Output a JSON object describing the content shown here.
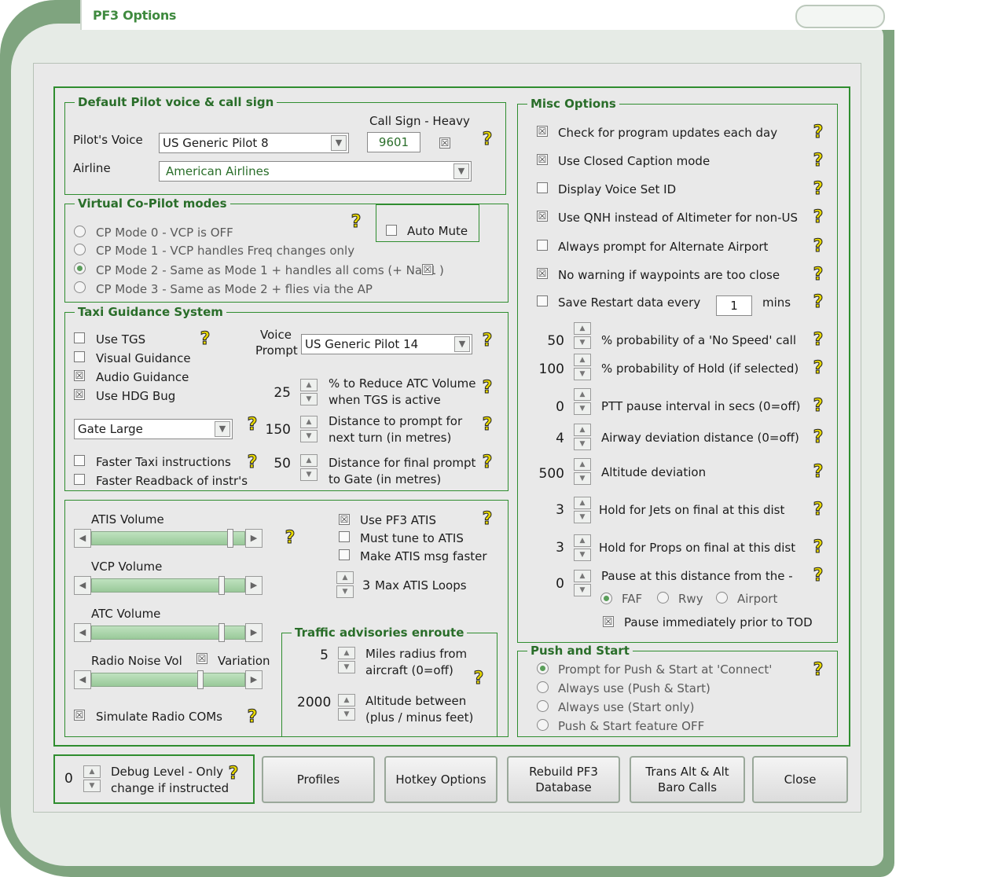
{
  "window": {
    "title": "PF3 Options"
  },
  "pilot": {
    "legend": "Default Pilot voice & call sign",
    "voice_label": "Pilot's Voice",
    "voice_value": "US Generic Pilot 8",
    "callsign_label": "Call Sign - Heavy",
    "callsign_value": "9601",
    "heavy_check": "☒",
    "airline_label": "Airline",
    "airline_value": "American Airlines"
  },
  "vcp": {
    "legend": "Virtual Co-Pilot modes",
    "auto_mute": "Auto Mute",
    "modes": [
      "CP Mode 0 - VCP is OFF",
      "CP Mode 1 - VCP handles Freq changes only",
      "CP Mode 2 - Same as Mode 1 + handles all coms (+ Nav1",
      "CP Mode 3 - Same as Mode 2 + flies via the AP"
    ],
    "mode2_suffix": ")",
    "nav1_check": "☒",
    "selected_mode": 2
  },
  "tgs": {
    "legend": "Taxi Guidance System",
    "use_tgs": "Use TGS",
    "visual": "Visual Guidance",
    "audio": "Audio Guidance",
    "hdg": "Use HDG Bug",
    "voice_prompt_1": "Voice",
    "voice_prompt_2": "Prompt",
    "voice_value": "US Generic Pilot 14",
    "gate_value": "Gate Large",
    "reduce_val": "25",
    "reduce_1": "% to Reduce ATC Volume",
    "reduce_2": "when TGS is active",
    "dist_val": "150",
    "dist_1": "Distance to prompt for",
    "dist_2": "next turn (in metres)",
    "final_val": "50",
    "final_1": "Distance for final prompt",
    "final_2": "to Gate (in metres)",
    "faster_taxi": "Faster Taxi instructions",
    "faster_readback": "Faster Readback of instr's",
    "checked": "☒"
  },
  "audio": {
    "atis_volume": "ATIS Volume",
    "vcp_volume": "VCP Volume",
    "atc_volume": "ATC Volume",
    "radio_noise": "Radio Noise Vol",
    "variation": "Variation",
    "simulate": "Simulate Radio COMs",
    "use_pf3_atis": "Use PF3 ATIS",
    "must_tune": "Must tune to ATIS",
    "faster_atis": "Make ATIS msg faster",
    "loops_val": "3",
    "loops_label": "Max ATIS Loops",
    "atis_level": 0.92,
    "vcp_level": 0.86,
    "atc_level": 0.86,
    "noise_level": 0.72,
    "checked": "☒"
  },
  "traffic": {
    "legend": "Traffic advisories enroute",
    "miles_val": "5",
    "miles_1": "Miles radius from",
    "miles_2": "aircraft (0=off)",
    "alt_val": "2000",
    "alt_1": "Altitude between",
    "alt_2": "(plus / minus feet)"
  },
  "misc": {
    "legend": "Misc Options",
    "checked": "☒",
    "updates": "Check for program updates each day",
    "caption": "Use Closed Caption mode",
    "voice_id": "Display Voice Set ID",
    "qnh": "Use QNH instead of Altimeter for non-US",
    "alternate": "Always prompt for Alternate Airport",
    "waypoints": "No warning if waypoints are too close",
    "restart": "Save Restart data every",
    "restart_val": "1",
    "restart_unit": "mins",
    "spins": [
      {
        "value": "50",
        "label": "% probability of a 'No Speed' call"
      },
      {
        "value": "100",
        "label": "% probability of Hold (if selected)"
      },
      {
        "value": "0",
        "label": "PTT pause interval in secs (0=off)"
      },
      {
        "value": "4",
        "label": "Airway deviation distance (0=off)"
      },
      {
        "value": "500",
        "label": "Altitude deviation"
      },
      {
        "value": "3",
        "label": "Hold for Jets on final at this dist"
      },
      {
        "value": "3",
        "label": "Hold for Props on final at this dist"
      },
      {
        "value": "0",
        "label": "Pause at this distance from the -"
      }
    ],
    "faf": "FAF",
    "rwy": "Rwy",
    "airport": "Airport",
    "pause_tod": "Pause immediately prior to TOD"
  },
  "push": {
    "legend": "Push and Start",
    "options": [
      "Prompt for Push & Start at 'Connect'",
      "Always use (Push & Start)",
      "Always use (Start only)",
      "Push & Start feature OFF"
    ],
    "selected": 0
  },
  "debug": {
    "value": "0",
    "line1": "Debug Level - Only",
    "line2": "change if instructed"
  },
  "buttons": {
    "profiles": "Profiles",
    "hotkey": "Hotkey Options",
    "rebuild": "Rebuild PF3\nDatabase",
    "trans": "Trans Alt & Alt\nBaro Calls",
    "close": "Close"
  },
  "icons": {
    "help": "?",
    "up": "▲",
    "down": "▼",
    "left": "◀",
    "right": "▶",
    "dropdown": "▼"
  },
  "colors": {
    "accent": "#2f8d2f",
    "skin": "#7fa47f",
    "title": "#3f8a3f",
    "help": "#e8d800"
  }
}
